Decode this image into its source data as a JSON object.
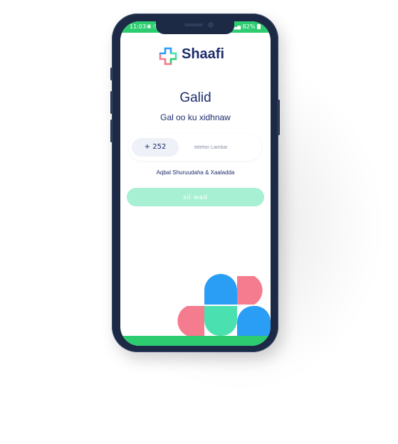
{
  "status_bar": {
    "time": "11:03",
    "left_icons": "▣ ◔",
    "battery": "82%",
    "signal": "▂▄▆"
  },
  "app": {
    "brand": "Shaafi"
  },
  "login": {
    "title": "Galid",
    "subtitle": "Gal oo ku xidhnaw",
    "country_code": "+ 252",
    "phone_placeholder": "telefon Lambar",
    "terms_text": "Aqbal Shuruudaha & Xaaladda",
    "submit_label": "sii wad"
  },
  "colors": {
    "green": "#2ecc71",
    "navy": "#1e2c6b",
    "mint_button": "#a8f0d3",
    "blue": "#2a9df4",
    "pink": "#f47c8e",
    "teal": "#4be0b0"
  }
}
